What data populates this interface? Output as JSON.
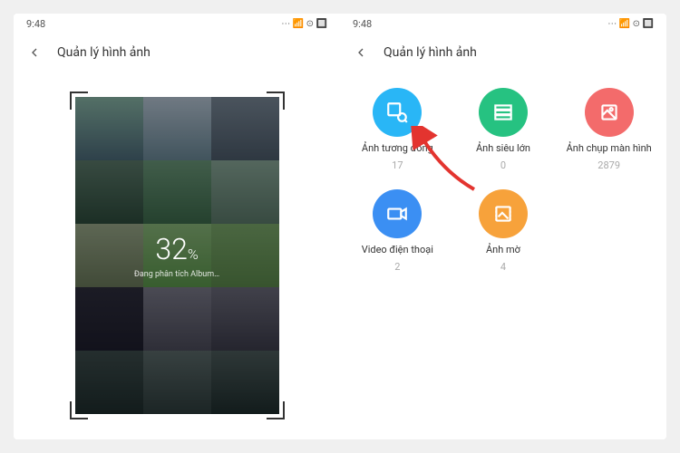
{
  "statusBar": {
    "time": "9:48",
    "indicators": "⋯  📶  ⊙  🔲"
  },
  "left": {
    "title": "Quản lý hình ảnh",
    "scan": {
      "percent": "32",
      "percent_suffix": "%",
      "status": "Đang phân tích Album…"
    }
  },
  "right": {
    "title": "Quản lý hình ảnh",
    "categories": [
      {
        "label": "Ảnh tương đồng",
        "count": "17",
        "color": "#29b6f6",
        "icon": "similar"
      },
      {
        "label": "Ảnh siêu lớn",
        "count": "0",
        "color": "#26c281",
        "icon": "large"
      },
      {
        "label": "Ảnh chụp màn hình",
        "count": "2879",
        "color": "#f36b6b",
        "icon": "screenshot"
      },
      {
        "label": "Video điện thoại",
        "count": "2",
        "color": "#3b8ff3",
        "icon": "video"
      },
      {
        "label": "Ảnh mờ",
        "count": "4",
        "color": "#f7a23b",
        "icon": "blurry"
      }
    ]
  }
}
